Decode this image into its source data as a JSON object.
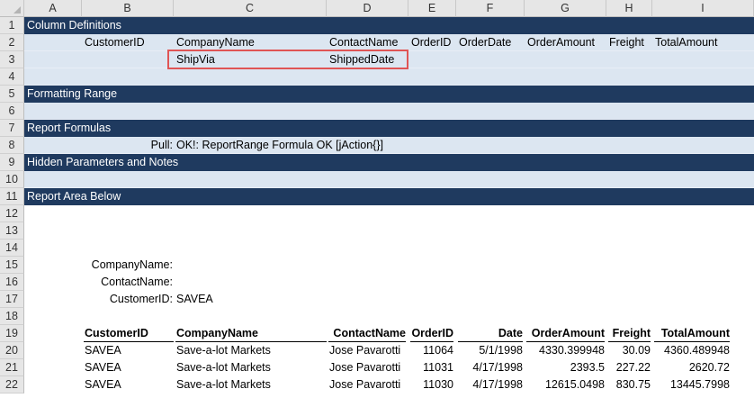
{
  "columns": [
    "A",
    "B",
    "C",
    "D",
    "E",
    "F",
    "G",
    "H",
    "I"
  ],
  "rows": [
    "1",
    "2",
    "3",
    "4",
    "5",
    "6",
    "7",
    "8",
    "9",
    "10",
    "11",
    "12",
    "13",
    "14",
    "15",
    "16",
    "17",
    "18",
    "19",
    "20",
    "21",
    "22"
  ],
  "sections": {
    "column_definitions": "Column Definitions",
    "formatting_range": "Formatting Range",
    "report_formulas": "Report Formulas",
    "hidden_parameters": "Hidden Parameters and Notes",
    "report_area": "Report Area Below"
  },
  "definitions_row2": [
    "CustomerID",
    "CompanyName",
    "ContactName",
    "OrderID",
    "OrderDate",
    "OrderAmount",
    "Freight",
    "TotalAmount"
  ],
  "definitions_row3": [
    "ShipVia",
    "ShippedDate"
  ],
  "formula": {
    "label": "Pull:",
    "value": "OK!: ReportRange Formula OK [jAction{}]"
  },
  "params": {
    "company_label": "CompanyName:",
    "contact_label": "ContactName:",
    "customer_label": "CustomerID:",
    "customer_value": "SAVEA"
  },
  "table": {
    "headers": [
      "CustomerID",
      "CompanyName",
      "ContactName",
      "OrderID",
      "Date",
      "OrderAmount",
      "Freight",
      "TotalAmount"
    ],
    "rows": [
      [
        "SAVEA",
        "Save-a-lot Markets",
        "Jose Pavarotti",
        "11064",
        "5/1/1998",
        "4330.399948",
        "30.09",
        "4360.489948"
      ],
      [
        "SAVEA",
        "Save-a-lot Markets",
        "Jose Pavarotti",
        "11031",
        "4/17/1998",
        "2393.5",
        "227.22",
        "2620.72"
      ],
      [
        "SAVEA",
        "Save-a-lot Markets",
        "Jose Pavarotti",
        "11030",
        "4/17/1998",
        "12615.0498",
        "830.75",
        "13445.7998"
      ]
    ]
  }
}
